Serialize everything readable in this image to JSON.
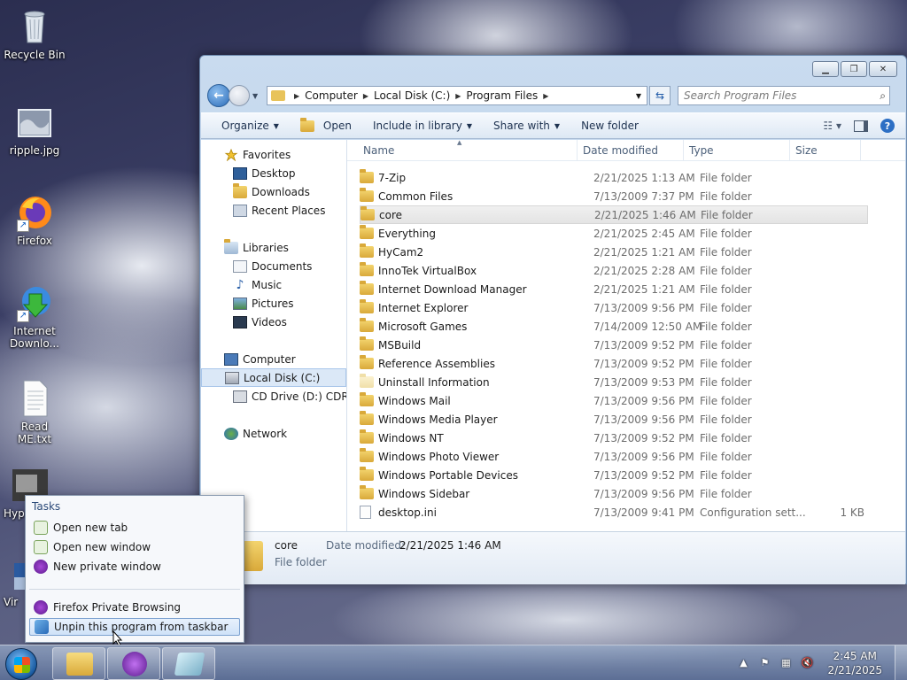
{
  "desktop": {
    "icons": [
      {
        "label": "Recycle Bin"
      },
      {
        "label": "ripple.jpg"
      },
      {
        "label": "Firefox"
      },
      {
        "label": "Internet Downlo..."
      },
      {
        "label": "Read ME.txt"
      },
      {
        "label": "Hyp"
      },
      {
        "label": "Vir"
      }
    ]
  },
  "explorer": {
    "breadcrumbs": [
      "Computer",
      "Local Disk (C:)",
      "Program Files"
    ],
    "search_placeholder": "Search Program Files",
    "toolbar": {
      "organize": "Organize",
      "open": "Open",
      "include_in_library": "Include in library",
      "share_with": "Share with",
      "new_folder": "New folder"
    },
    "nav": {
      "favorites": "Favorites",
      "desktop": "Desktop",
      "downloads": "Downloads",
      "recent_places": "Recent Places",
      "libraries": "Libraries",
      "documents": "Documents",
      "music": "Music",
      "pictures": "Pictures",
      "videos": "Videos",
      "computer": "Computer",
      "local_disk": "Local Disk (C:)",
      "cd_drive": "CD Drive (D:) CDROM",
      "network": "Network"
    },
    "columns": {
      "name": "Name",
      "date": "Date modified",
      "type": "Type",
      "size": "Size"
    },
    "files": [
      {
        "name": "7-Zip",
        "date": "2/21/2025 1:13 AM",
        "type": "File folder",
        "size": ""
      },
      {
        "name": "Common Files",
        "date": "7/13/2009 7:37 PM",
        "type": "File folder",
        "size": ""
      },
      {
        "name": "core",
        "date": "2/21/2025 1:46 AM",
        "type": "File folder",
        "size": ""
      },
      {
        "name": "Everything",
        "date": "2/21/2025 2:45 AM",
        "type": "File folder",
        "size": ""
      },
      {
        "name": "HyCam2",
        "date": "2/21/2025 1:21 AM",
        "type": "File folder",
        "size": ""
      },
      {
        "name": "InnoTek VirtualBox",
        "date": "2/21/2025 2:28 AM",
        "type": "File folder",
        "size": ""
      },
      {
        "name": "Internet Download Manager",
        "date": "2/21/2025 1:21 AM",
        "type": "File folder",
        "size": ""
      },
      {
        "name": "Internet Explorer",
        "date": "7/13/2009 9:56 PM",
        "type": "File folder",
        "size": ""
      },
      {
        "name": "Microsoft Games",
        "date": "7/14/2009 12:50 AM",
        "type": "File folder",
        "size": ""
      },
      {
        "name": "MSBuild",
        "date": "7/13/2009 9:52 PM",
        "type": "File folder",
        "size": ""
      },
      {
        "name": "Reference Assemblies",
        "date": "7/13/2009 9:52 PM",
        "type": "File folder",
        "size": ""
      },
      {
        "name": "Uninstall Information",
        "date": "7/13/2009 9:53 PM",
        "type": "File folder",
        "size": ""
      },
      {
        "name": "Windows Mail",
        "date": "7/13/2009 9:56 PM",
        "type": "File folder",
        "size": ""
      },
      {
        "name": "Windows Media Player",
        "date": "7/13/2009 9:56 PM",
        "type": "File folder",
        "size": ""
      },
      {
        "name": "Windows NT",
        "date": "7/13/2009 9:52 PM",
        "type": "File folder",
        "size": ""
      },
      {
        "name": "Windows Photo Viewer",
        "date": "7/13/2009 9:56 PM",
        "type": "File folder",
        "size": ""
      },
      {
        "name": "Windows Portable Devices",
        "date": "7/13/2009 9:52 PM",
        "type": "File folder",
        "size": ""
      },
      {
        "name": "Windows Sidebar",
        "date": "7/13/2009 9:56 PM",
        "type": "File folder",
        "size": ""
      },
      {
        "name": "desktop.ini",
        "date": "7/13/2009 9:41 PM",
        "type": "Configuration sett...",
        "size": "1 KB"
      }
    ],
    "details": {
      "name": "core",
      "date_label": "Date modified:",
      "date_value": "2/21/2025 1:46 AM",
      "type": "File folder"
    }
  },
  "jumplist": {
    "header": "Tasks",
    "items": {
      "new_tab": "Open new tab",
      "new_window": "Open new window",
      "new_private": "New private window",
      "app_name": "Firefox Private Browsing",
      "unpin": "Unpin this program from taskbar"
    }
  },
  "taskbar": {
    "time": "2:45 AM",
    "date": "2/21/2025"
  },
  "colors": {
    "selection": "#cfe2f8",
    "folder": "#e8c35a",
    "accent": "#2a6bb8"
  }
}
